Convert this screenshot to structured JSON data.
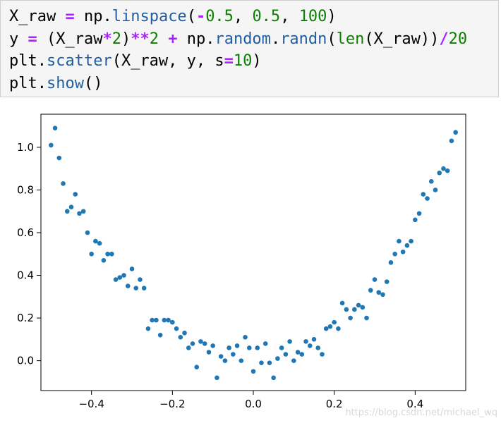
{
  "code_cell": {
    "lines": [
      [
        {
          "t": "X_raw ",
          "c": "pl"
        },
        {
          "t": "=",
          "c": "op"
        },
        {
          "t": " np.",
          "c": "pl"
        },
        {
          "t": "linspace",
          "c": "fn"
        },
        {
          "t": "(",
          "c": "pl"
        },
        {
          "t": "-",
          "c": "op"
        },
        {
          "t": "0.5",
          "c": "num"
        },
        {
          "t": ", ",
          "c": "pl"
        },
        {
          "t": "0.5",
          "c": "num"
        },
        {
          "t": ", ",
          "c": "pl"
        },
        {
          "t": "100",
          "c": "num"
        },
        {
          "t": ")",
          "c": "pl"
        }
      ],
      [
        {
          "t": "y ",
          "c": "pl"
        },
        {
          "t": "=",
          "c": "op"
        },
        {
          "t": " (X_raw",
          "c": "pl"
        },
        {
          "t": "*",
          "c": "op"
        },
        {
          "t": "2",
          "c": "num"
        },
        {
          "t": ")",
          "c": "pl"
        },
        {
          "t": "**",
          "c": "op"
        },
        {
          "t": "2",
          "c": "num"
        },
        {
          "t": " ",
          "c": "pl"
        },
        {
          "t": "+",
          "c": "op"
        },
        {
          "t": " np.",
          "c": "pl"
        },
        {
          "t": "random",
          "c": "fn"
        },
        {
          "t": ".",
          "c": "pl"
        },
        {
          "t": "randn",
          "c": "fn"
        },
        {
          "t": "(",
          "c": "pl"
        },
        {
          "t": "len",
          "c": "kw"
        },
        {
          "t": "(X_raw))",
          "c": "pl"
        },
        {
          "t": "/",
          "c": "op"
        },
        {
          "t": "20",
          "c": "num"
        }
      ],
      [
        {
          "t": "plt.",
          "c": "pl"
        },
        {
          "t": "scatter",
          "c": "fn"
        },
        {
          "t": "(X_raw, y, s",
          "c": "pl"
        },
        {
          "t": "=",
          "c": "op"
        },
        {
          "t": "10",
          "c": "num"
        },
        {
          "t": ")",
          "c": "pl"
        }
      ],
      [
        {
          "t": "plt.",
          "c": "pl"
        },
        {
          "t": "show",
          "c": "fn"
        },
        {
          "t": "()",
          "c": "pl"
        }
      ]
    ]
  },
  "watermark": "https://blog.csdn.net/michael_wq",
  "colors": {
    "marker": "#1f77b4",
    "axes": "#000000",
    "code_bg": "#f5f5f5"
  },
  "chart_data": {
    "type": "scatter",
    "xlim": [
      -0.525,
      0.525
    ],
    "ylim": [
      -0.14,
      1.155
    ],
    "xticks": [
      -0.4,
      -0.2,
      0.0,
      0.2,
      0.4
    ],
    "xtick_labels": [
      "−0.4",
      "−0.2",
      "0.0",
      "0.2",
      "0.4"
    ],
    "yticks": [
      0.0,
      0.2,
      0.4,
      0.6,
      0.8,
      1.0
    ],
    "ytick_labels": [
      "0.0",
      "0.2",
      "0.4",
      "0.6",
      "0.8",
      "1.0"
    ],
    "grid": false,
    "points": [
      [
        -0.5,
        1.01
      ],
      [
        -0.49,
        1.09
      ],
      [
        -0.48,
        0.95
      ],
      [
        -0.47,
        0.83
      ],
      [
        -0.46,
        0.7
      ],
      [
        -0.45,
        0.72
      ],
      [
        -0.44,
        0.78
      ],
      [
        -0.43,
        0.69
      ],
      [
        -0.42,
        0.7
      ],
      [
        -0.41,
        0.6
      ],
      [
        -0.4,
        0.5
      ],
      [
        -0.39,
        0.56
      ],
      [
        -0.38,
        0.55
      ],
      [
        -0.37,
        0.47
      ],
      [
        -0.36,
        0.5
      ],
      [
        -0.35,
        0.5
      ],
      [
        -0.34,
        0.38
      ],
      [
        -0.33,
        0.39
      ],
      [
        -0.32,
        0.4
      ],
      [
        -0.31,
        0.35
      ],
      [
        -0.3,
        0.43
      ],
      [
        -0.29,
        0.34
      ],
      [
        -0.28,
        0.38
      ],
      [
        -0.27,
        0.34
      ],
      [
        -0.26,
        0.15
      ],
      [
        -0.25,
        0.19
      ],
      [
        -0.24,
        0.19
      ],
      [
        -0.23,
        0.12
      ],
      [
        -0.22,
        0.19
      ],
      [
        -0.21,
        0.19
      ],
      [
        -0.2,
        0.18
      ],
      [
        -0.19,
        0.15
      ],
      [
        -0.18,
        0.11
      ],
      [
        -0.17,
        0.13
      ],
      [
        -0.16,
        0.06
      ],
      [
        -0.15,
        0.08
      ],
      [
        -0.14,
        -0.03
      ],
      [
        -0.13,
        0.09
      ],
      [
        -0.12,
        0.08
      ],
      [
        -0.11,
        0.04
      ],
      [
        -0.1,
        0.07
      ],
      [
        -0.09,
        -0.08
      ],
      [
        -0.08,
        0.02
      ],
      [
        -0.07,
        0.0
      ],
      [
        -0.06,
        0.06
      ],
      [
        -0.05,
        0.03
      ],
      [
        -0.04,
        0.07
      ],
      [
        -0.03,
        0.0
      ],
      [
        -0.02,
        0.11
      ],
      [
        -0.01,
        0.06
      ],
      [
        0.0,
        -0.05
      ],
      [
        0.01,
        0.06
      ],
      [
        0.02,
        -0.01
      ],
      [
        0.03,
        0.08
      ],
      [
        0.04,
        -0.01
      ],
      [
        0.05,
        -0.08
      ],
      [
        0.06,
        0.01
      ],
      [
        0.07,
        0.06
      ],
      [
        0.08,
        0.03
      ],
      [
        0.09,
        0.09
      ],
      [
        0.1,
        0.0
      ],
      [
        0.11,
        0.04
      ],
      [
        0.12,
        0.03
      ],
      [
        0.13,
        0.09
      ],
      [
        0.14,
        0.07
      ],
      [
        0.15,
        0.1
      ],
      [
        0.16,
        0.06
      ],
      [
        0.17,
        0.03
      ],
      [
        0.18,
        0.15
      ],
      [
        0.19,
        0.16
      ],
      [
        0.2,
        0.18
      ],
      [
        0.21,
        0.15
      ],
      [
        0.22,
        0.27
      ],
      [
        0.23,
        0.24
      ],
      [
        0.24,
        0.2
      ],
      [
        0.25,
        0.24
      ],
      [
        0.26,
        0.26
      ],
      [
        0.27,
        0.25
      ],
      [
        0.28,
        0.2
      ],
      [
        0.29,
        0.33
      ],
      [
        0.3,
        0.38
      ],
      [
        0.31,
        0.32
      ],
      [
        0.32,
        0.31
      ],
      [
        0.33,
        0.37
      ],
      [
        0.34,
        0.46
      ],
      [
        0.35,
        0.5
      ],
      [
        0.36,
        0.56
      ],
      [
        0.37,
        0.51
      ],
      [
        0.38,
        0.54
      ],
      [
        0.39,
        0.56
      ],
      [
        0.4,
        0.66
      ],
      [
        0.41,
        0.69
      ],
      [
        0.42,
        0.78
      ],
      [
        0.43,
        0.76
      ],
      [
        0.44,
        0.84
      ],
      [
        0.45,
        0.8
      ],
      [
        0.46,
        0.88
      ],
      [
        0.47,
        0.9
      ],
      [
        0.48,
        0.89
      ],
      [
        0.49,
        1.03
      ],
      [
        0.5,
        1.07
      ]
    ]
  }
}
